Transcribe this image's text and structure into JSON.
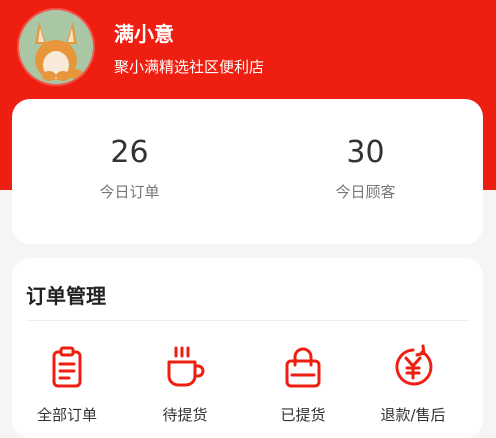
{
  "profile": {
    "user_name": "满小意",
    "shop_name": "聚小满精选社区便利店",
    "avatar_icon": "fox-avatar"
  },
  "stats": {
    "today_orders_value": "26",
    "today_orders_label": "今日订单",
    "today_customers_value": "30",
    "today_customers_label": "今日顾客"
  },
  "orders": {
    "title": "订单管理",
    "items": [
      {
        "icon": "clipboard-icon",
        "label": "全部订单"
      },
      {
        "icon": "coffee-cup-icon",
        "label": "待提货"
      },
      {
        "icon": "shopping-bag-icon",
        "label": "已提货"
      },
      {
        "icon": "yuan-refund-icon",
        "label": "退款/售后"
      }
    ]
  },
  "colors": {
    "brand_red": "#ee1f11",
    "page_bg": "#f5f5f5"
  }
}
